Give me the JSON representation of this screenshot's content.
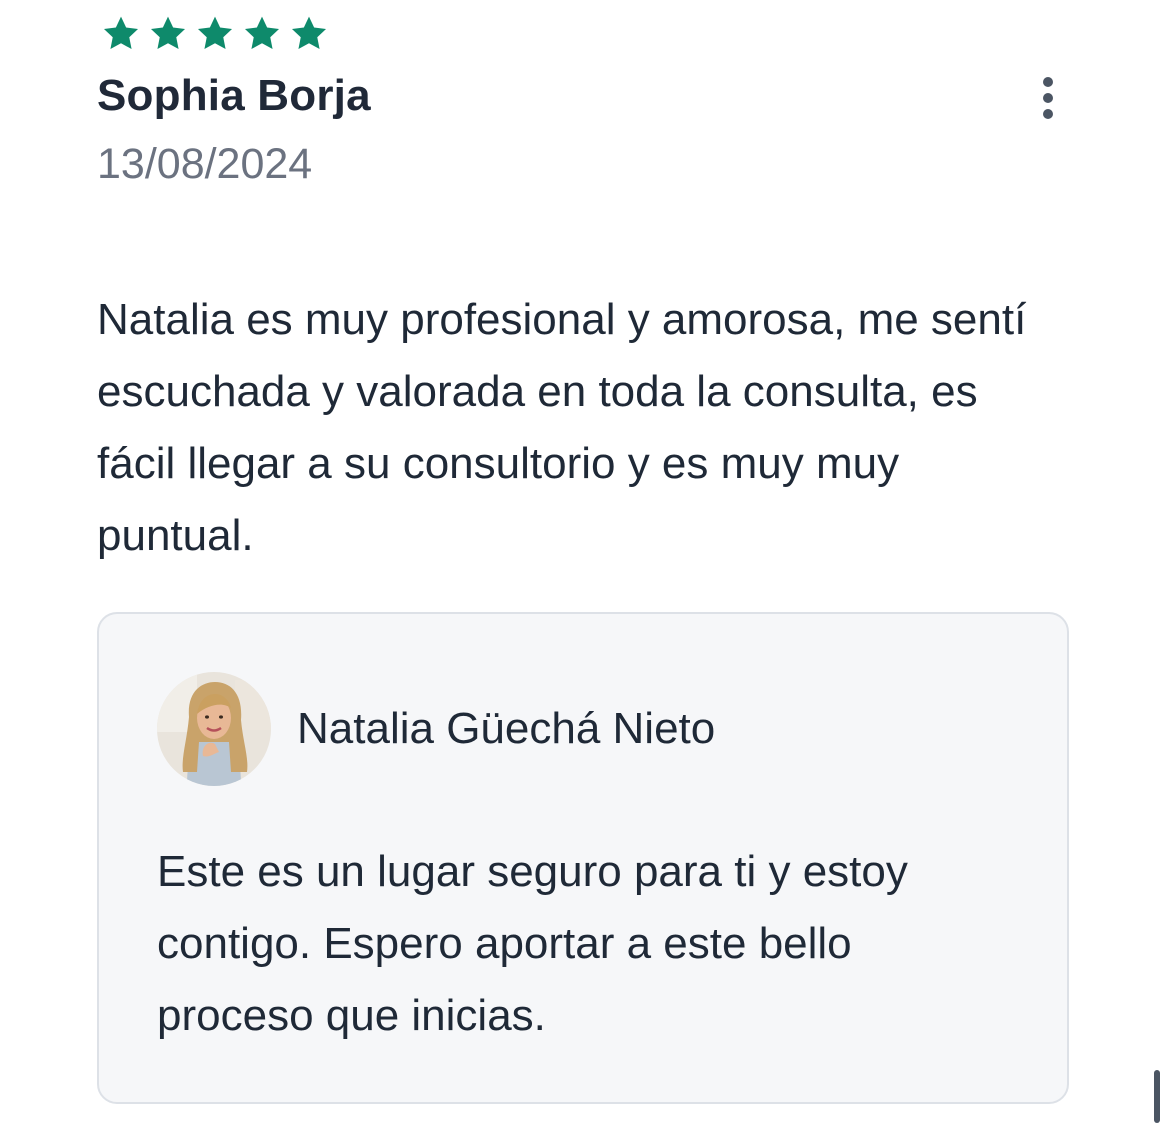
{
  "review": {
    "rating": 5,
    "rating_max": 5,
    "star_color": "#0e8a6b",
    "author": "Sophia Borja",
    "date": "13/08/2024",
    "comment": "Natalia es muy profesional y amorosa, me sentí escuchada y valorada en toda la consulta, es fácil llegar a su consultorio y es muy muy puntual.",
    "menu_icon": "more-vertical-icon"
  },
  "reply": {
    "name": "Natalia Güechá Nieto",
    "text": "Este es un lugar seguro para ti y estoy contigo. Espero aportar a este bello proceso que inicias.",
    "avatar": "profile-photo"
  },
  "colors": {
    "text": "#1f2937",
    "muted": "#6b7280",
    "reply_bg": "#f6f7f9",
    "reply_border": "#dde1e7"
  }
}
